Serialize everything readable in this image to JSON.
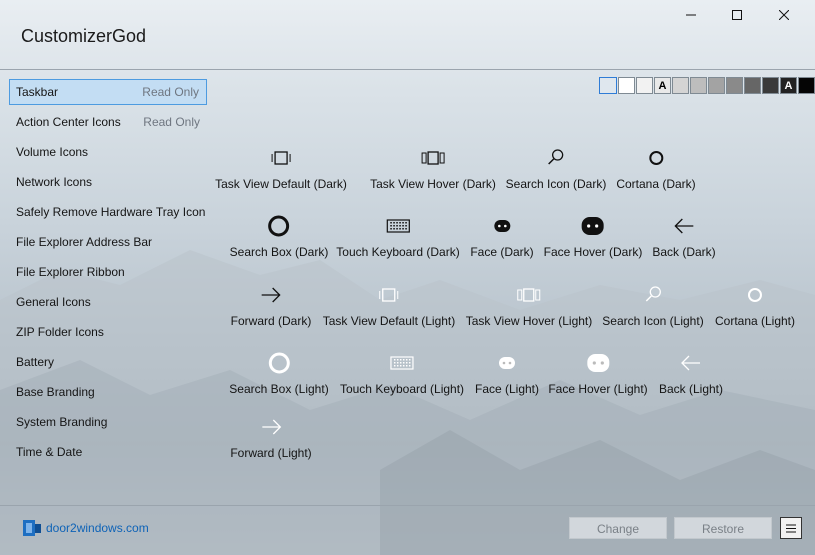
{
  "app": {
    "title": "CustomizerGod"
  },
  "window_controls": {
    "minimize_icon": "minimize-icon",
    "maximize_icon": "maximize-icon",
    "close_icon": "close-icon"
  },
  "sidebar": {
    "items": [
      {
        "label": "Taskbar",
        "badge": "Read Only",
        "selected": true
      },
      {
        "label": "Action Center Icons",
        "badge": "Read Only"
      },
      {
        "label": "Volume Icons"
      },
      {
        "label": "Network Icons"
      },
      {
        "label": "Safely Remove Hardware Tray Icon"
      },
      {
        "label": "File Explorer Address Bar"
      },
      {
        "label": "File Explorer Ribbon"
      },
      {
        "label": "General Icons"
      },
      {
        "label": "ZIP Folder Icons"
      },
      {
        "label": "Battery"
      },
      {
        "label": "Base Branding"
      },
      {
        "label": "System Branding"
      },
      {
        "label": "Time & Date"
      }
    ]
  },
  "swatches": {
    "selected_index": 0,
    "items": [
      {
        "color": "#dfe7ee",
        "text": ""
      },
      {
        "color": "#ffffff",
        "text": ""
      },
      {
        "color": "#f2f2f2",
        "text": ""
      },
      {
        "color": "#e9e9e9",
        "text": "A"
      },
      {
        "color": "#d4d4d4",
        "text": ""
      },
      {
        "color": "#bdbdbd",
        "text": ""
      },
      {
        "color": "#a3a3a3",
        "text": ""
      },
      {
        "color": "#8a8a8a",
        "text": ""
      },
      {
        "color": "#666666",
        "text": ""
      },
      {
        "color": "#3a3a3a",
        "text": ""
      },
      {
        "color": "#222222",
        "text": "A"
      },
      {
        "color": "#050505",
        "text": ""
      }
    ]
  },
  "icons": {
    "items": [
      {
        "label": "Task View Default (Dark)",
        "icon": "task-view-icon"
      },
      {
        "label": "Task View Hover (Dark)",
        "icon": "task-view-hover-icon"
      },
      {
        "label": "Search Icon (Dark)",
        "icon": "search-icon"
      },
      {
        "label": "Cortana (Dark)",
        "icon": "cortana-icon"
      },
      {
        "label": "Search Box (Dark)",
        "icon": "search-box-icon"
      },
      {
        "label": "Touch Keyboard (Dark)",
        "icon": "keyboard-icon"
      },
      {
        "label": "Face (Dark)",
        "icon": "face-icon"
      },
      {
        "label": "Face Hover (Dark)",
        "icon": "face-hover-icon"
      },
      {
        "label": "Back (Dark)",
        "icon": "back-arrow-icon"
      },
      {
        "label": "Forward (Dark)",
        "icon": "forward-arrow-icon"
      },
      {
        "label": "Task View Default (Light)",
        "icon": "task-view-icon"
      },
      {
        "label": "Task View Hover (Light)",
        "icon": "task-view-hover-icon"
      },
      {
        "label": "Search Icon (Light)",
        "icon": "search-icon"
      },
      {
        "label": "Cortana (Light)",
        "icon": "cortana-icon"
      },
      {
        "label": "Search Box (Light)",
        "icon": "search-box-icon"
      },
      {
        "label": "Touch Keyboard (Light)",
        "icon": "keyboard-icon"
      },
      {
        "label": "Face (Light)",
        "icon": "face-icon"
      },
      {
        "label": "Face Hover (Light)",
        "icon": "face-hover-icon"
      },
      {
        "label": "Back (Light)",
        "icon": "back-arrow-icon"
      },
      {
        "label": "Forward (Light)",
        "icon": "forward-arrow-icon"
      }
    ]
  },
  "footer": {
    "brand": "door2windows.com",
    "change_label": "Change",
    "restore_label": "Restore",
    "menu_icon": "hamburger-menu-icon"
  }
}
